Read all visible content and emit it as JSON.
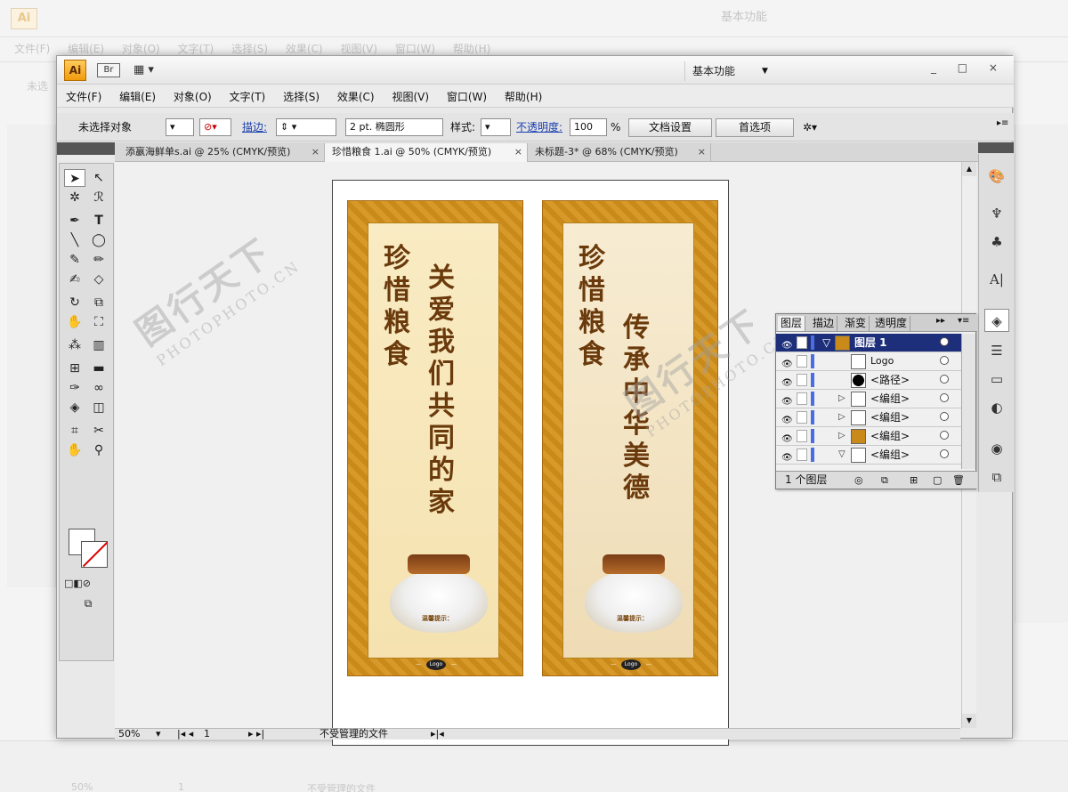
{
  "background": {
    "workspace": "基本功能",
    "menu": [
      "文件(F)",
      "编辑(E)",
      "对象(O)",
      "文字(T)",
      "选择(S)",
      "效果(C)",
      "视图(V)",
      "窗口(W)",
      "帮助(H)"
    ],
    "left_label": "未选",
    "zoom": "50%",
    "page": "1",
    "status": "不受管理的文件"
  },
  "app": {
    "logo": "Ai",
    "bridge": "Br",
    "workspace": "基本功能",
    "window_controls": "_ □ ×"
  },
  "menu": [
    "文件(F)",
    "编辑(E)",
    "对象(O)",
    "文字(T)",
    "选择(S)",
    "效果(C)",
    "视图(V)",
    "窗口(W)",
    "帮助(H)"
  ],
  "control": {
    "selection": "未选择对象",
    "stroke_label": "描边:",
    "brush": "2 pt. 椭圆形",
    "style_label": "样式:",
    "opacity_label": "不透明度:",
    "opacity_value": "100",
    "opacity_unit": "%",
    "doc_settings": "文档设置",
    "preferences": "首选项"
  },
  "tabs": [
    {
      "label": "添嬴海鲜单s.ai @ 25% (CMYK/预览)",
      "active": false
    },
    {
      "label": "珍惜粮食 1.ai @ 50% (CMYK/预览)",
      "active": true
    },
    {
      "label": "未标题-3* @ 68% (CMYK/预览)",
      "active": false
    }
  ],
  "artwork": {
    "left": {
      "title": "珍惜粮食",
      "slogan": "关爱我们共同的家"
    },
    "right": {
      "title": "珍惜粮食",
      "slogan": "传承中华美德"
    },
    "notice": "温馨提示：",
    "logo": "Logo"
  },
  "watermark": {
    "brand": "图行天下",
    "site": "PHOTOPHOTO.CN"
  },
  "layers": {
    "tabs": [
      "图层",
      "描边",
      "渐变",
      "透明度"
    ],
    "rows": [
      {
        "name": "图层 1",
        "selected": true,
        "expand": "▽"
      },
      {
        "name": "Logo",
        "selected": false,
        "expand": ""
      },
      {
        "name": "<路径>",
        "selected": false,
        "expand": ""
      },
      {
        "name": "<编组>",
        "selected": false,
        "expand": "▷"
      },
      {
        "name": "<编组>",
        "selected": false,
        "expand": "▷"
      },
      {
        "name": "<编组>",
        "selected": false,
        "expand": "▷"
      },
      {
        "name": "<编组>",
        "selected": false,
        "expand": "▽"
      }
    ],
    "footer": "1 个图层"
  },
  "status": {
    "zoom": "50%",
    "page": "1",
    "file_status": "不受管理的文件"
  }
}
